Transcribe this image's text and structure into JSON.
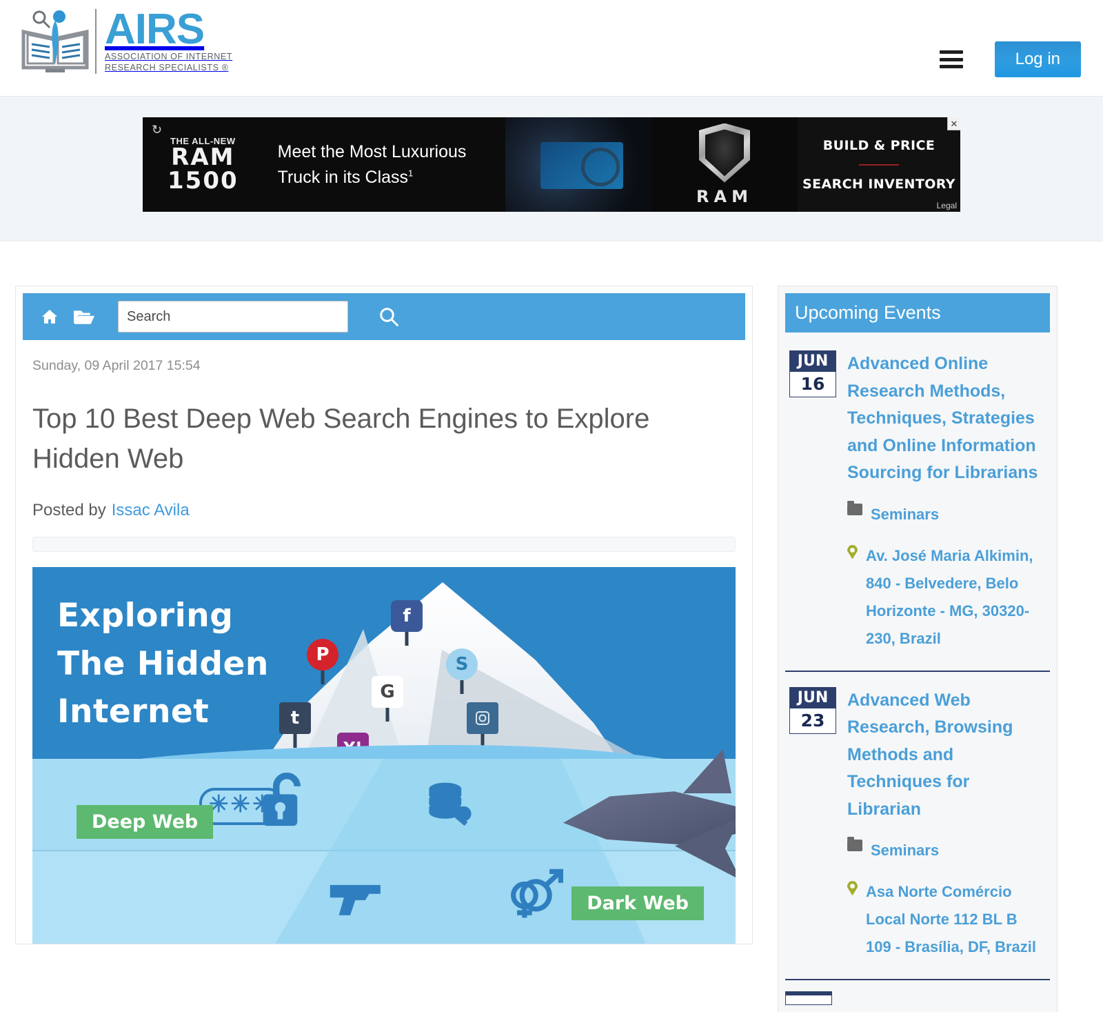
{
  "header": {
    "logo_title": "AIRS",
    "logo_subtitle_line1": "ASSOCIATION OF INTERNET",
    "logo_subtitle_line2": "RESEARCH SPECIALISTS ®",
    "menu_icon": "hamburger-icon",
    "login_label": "Log in"
  },
  "ad": {
    "refresh_glyph": "↻",
    "eyebrow": "THE ALL-NEW",
    "brand_line1": "RAM",
    "brand_line2": "1500",
    "headline": "Meet the Most Luxurious Truck in its Class",
    "headline_sup": "1",
    "ram_wordmark": "RAM",
    "cta_primary": "BUILD & PRICE",
    "cta_secondary": "SEARCH INVENTORY",
    "legal_label": "Legal",
    "close_label": "✕"
  },
  "toolbar": {
    "home_icon": "home-icon",
    "folder_icon": "folder-open-icon",
    "search_placeholder": "Search",
    "search_value": "",
    "search_button_icon": "search-icon"
  },
  "article": {
    "date": "Sunday, 09 April 2017 15:54",
    "title": "Top 10 Best Deep Web Search Engines to Explore Hidden Web",
    "posted_by_label": "Posted by",
    "author": "Issac Avila"
  },
  "infographic": {
    "headline_line1": "Exploring",
    "headline_line2": "The Hidden",
    "headline_line3": "Internet",
    "tag_deep": "Deep Web",
    "tag_dark": "Dark Web",
    "pins": [
      {
        "name": "facebook-pin",
        "glyph": "f"
      },
      {
        "name": "pinterest-pin",
        "glyph": "P"
      },
      {
        "name": "google-pin",
        "glyph": "G"
      },
      {
        "name": "skype-pin",
        "glyph": "S"
      },
      {
        "name": "tumblr-pin",
        "glyph": "t"
      },
      {
        "name": "yahoo-pin",
        "glyph": "Y!"
      },
      {
        "name": "instagram-pin",
        "glyph": "Instagram"
      }
    ],
    "glyphs": {
      "password": "✳✳✳",
      "lock": "🔓",
      "database": "🗄",
      "gun": "🔫",
      "gender": "⚥"
    }
  },
  "sidebar": {
    "title": "Upcoming Events",
    "events": [
      {
        "month": "JUN",
        "day": "16",
        "title": "Advanced Online Research Methods, Techniques, Strategies and Online Information Sourcing for Librarians",
        "category": "Seminars",
        "location": "Av. José Maria Alkimin, 840 - Belvedere, Belo Horizonte - MG, 30320-230, Brazil"
      },
      {
        "month": "JUN",
        "day": "23",
        "title": "Advanced Web Research, Browsing Methods and Techniques for Librarian",
        "category": "Seminars",
        "location": "Asa Norte Comércio Local Norte 112 BL B 109 - Brasília, DF, Brazil"
      }
    ]
  },
  "colors": {
    "brand_blue": "#4aa3dc",
    "link_blue": "#4a9fd8",
    "date_navy": "#2c3e6b",
    "tag_green": "#5cb96f",
    "ad_black": "#0c0c0c"
  }
}
